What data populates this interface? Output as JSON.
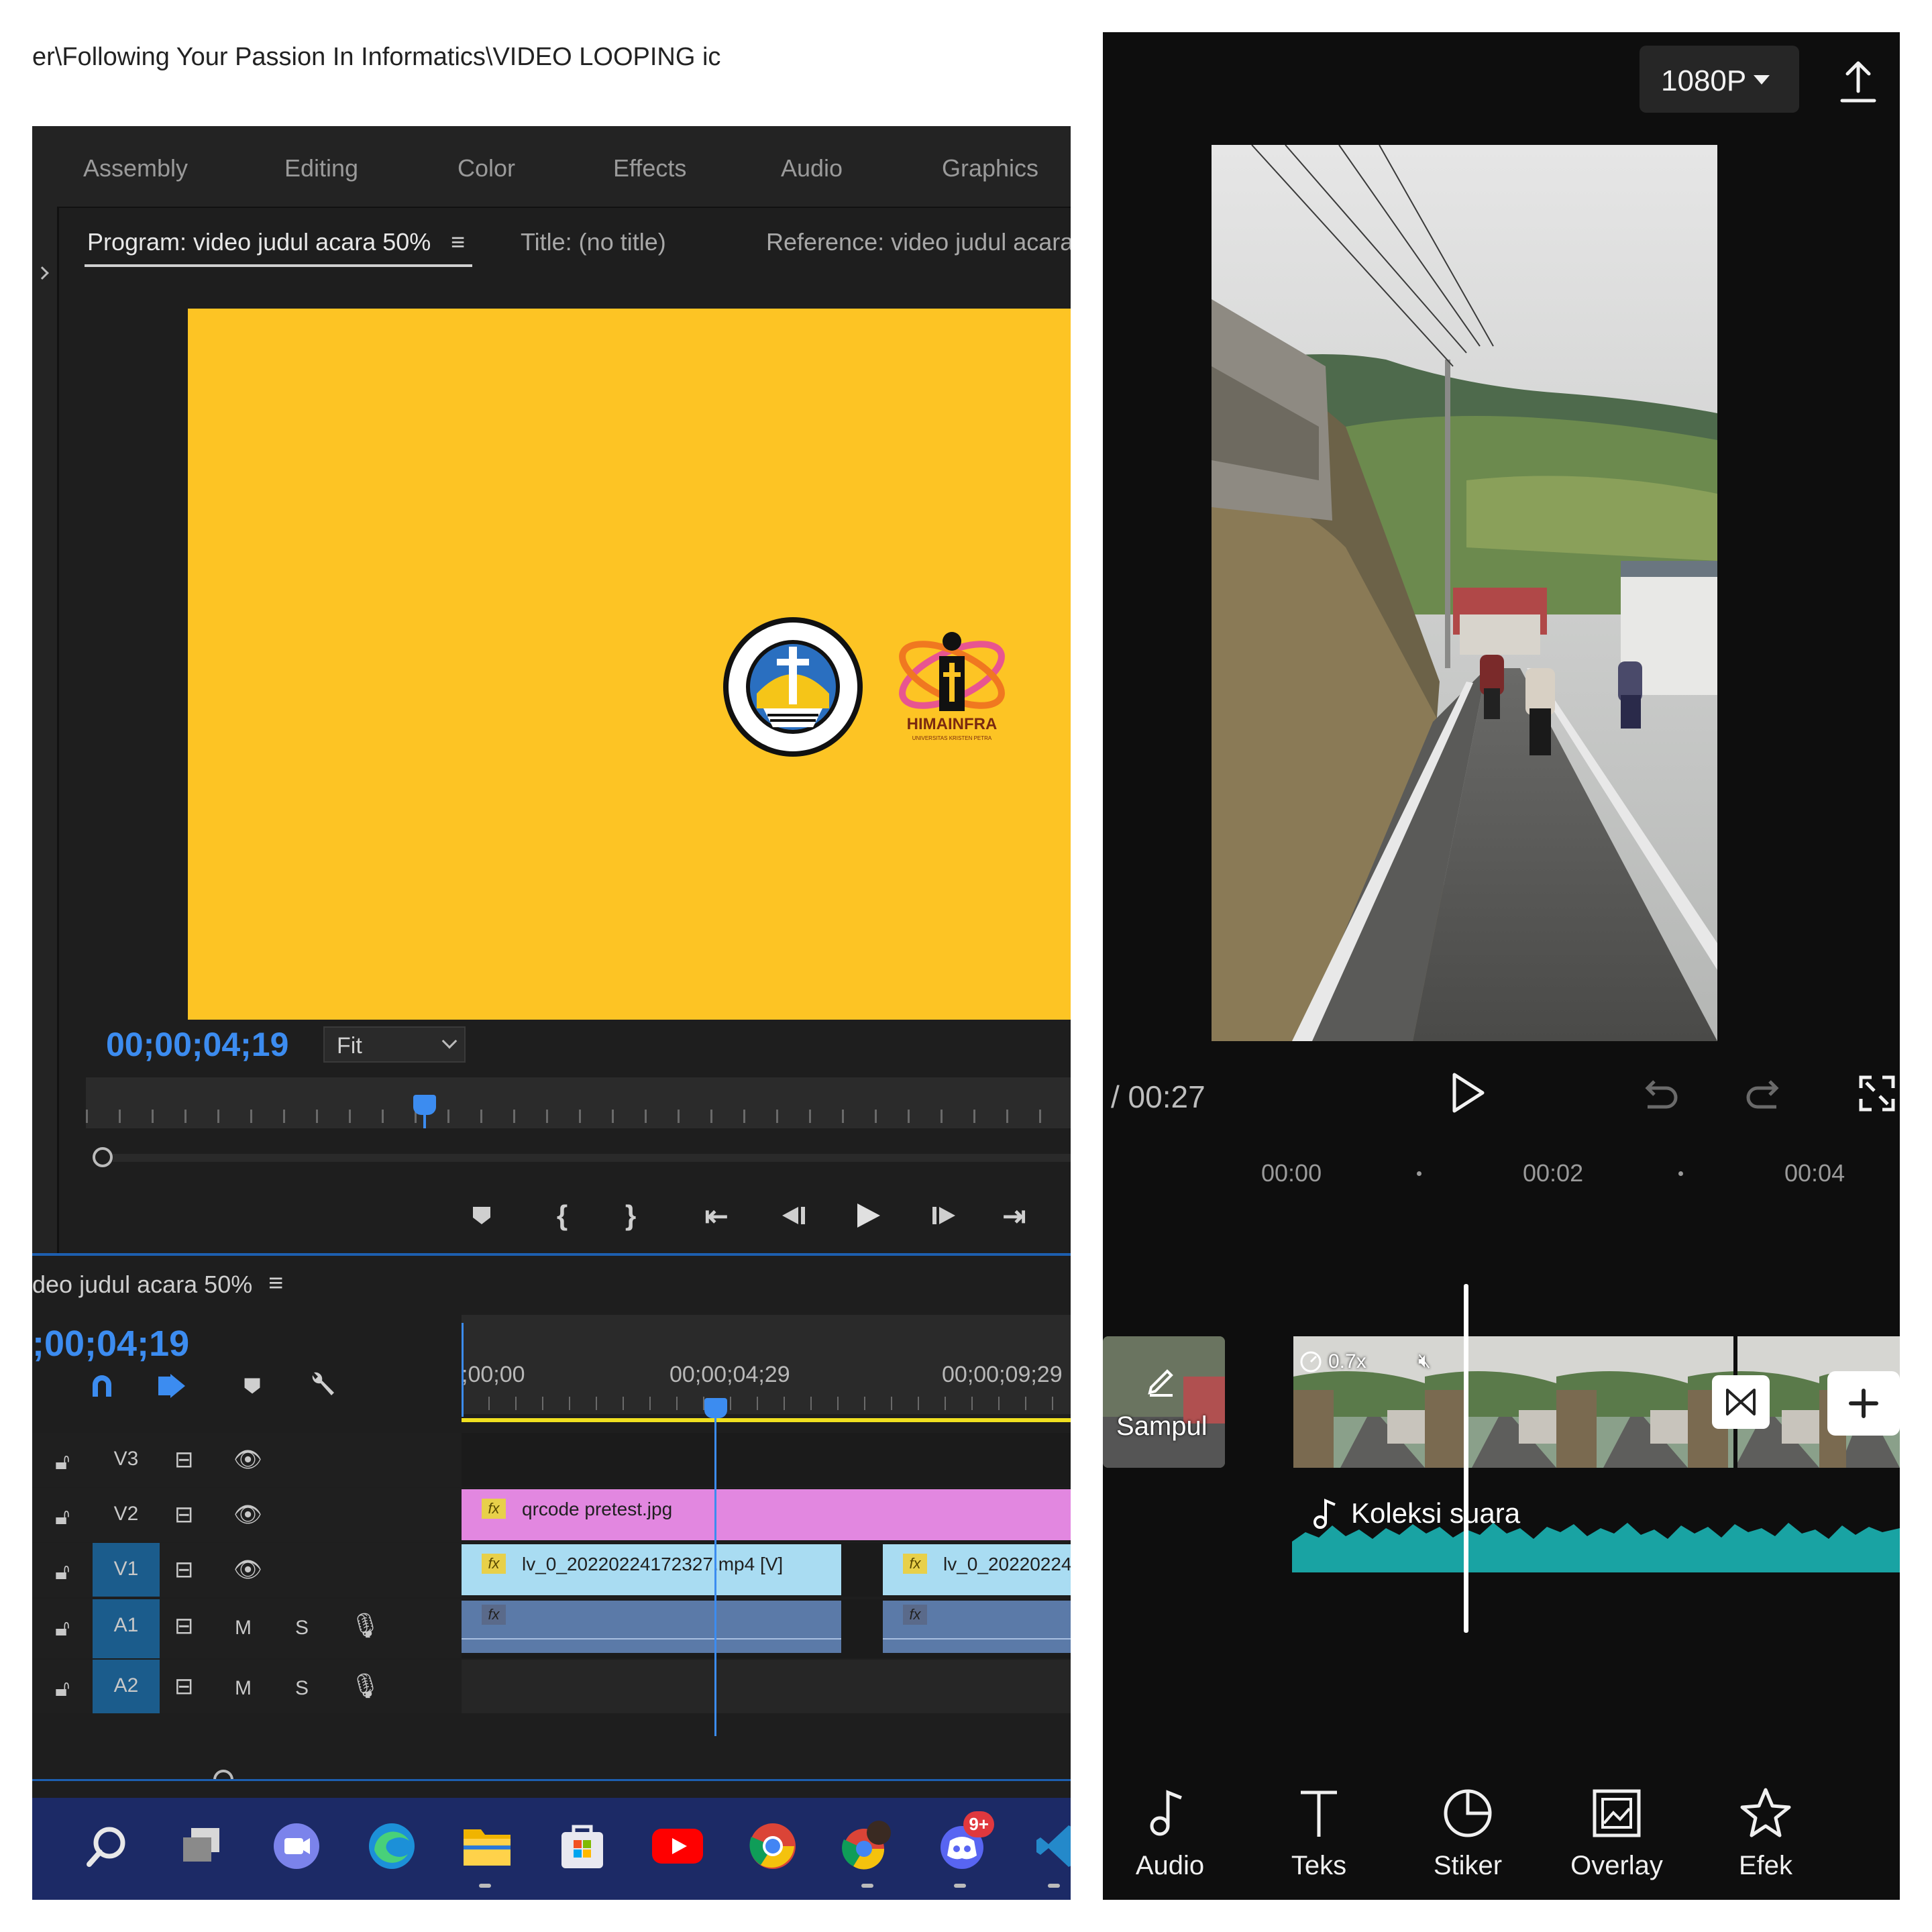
{
  "premiere": {
    "path_text": "er\\Following Your Passion In Informatics\\VIDEO LOOPING ic",
    "workspace_tabs": [
      "Assembly",
      "Editing",
      "Color",
      "Effects",
      "Audio",
      "Graphics"
    ],
    "program_tab": "Program: video judul acara 50%",
    "title_tab": "Title: (no title)",
    "reference_tab": "Reference: video judul acara :",
    "frame_color": "#fdc424",
    "logo_text": "HIMAINFRA",
    "logo_subtext": "UNIVERSITAS KRISTEN PETRA",
    "seal_text": "UNIVERSITAS KRISTEN PETRA",
    "program_timecode": "00;00;04;19",
    "fit_label": "Fit",
    "timeline": {
      "sequence_title": "deo judul acara 50%",
      "timecode": ";00;04;19",
      "ruler_labels": [
        ";00;00",
        "00;00;04;29",
        "00;00;09;29"
      ],
      "tracks": [
        {
          "name": "V3",
          "type": "video",
          "selected": false
        },
        {
          "name": "V2",
          "type": "video",
          "selected": false
        },
        {
          "name": "V1",
          "type": "video",
          "selected": true
        },
        {
          "name": "A1",
          "type": "audio",
          "selected": true
        },
        {
          "name": "A2",
          "type": "audio",
          "selected": true
        }
      ],
      "clips": {
        "v2": "qrcode pretest.jpg",
        "v1_a": "lv_0_20220224172327.mp4 [V]",
        "v1_b": "lv_0_20220224"
      },
      "fx_label": "fx",
      "mute_label": "M",
      "solo_label": "S"
    },
    "taskbar_badge": "9+"
  },
  "capcut": {
    "resolution": "1080P",
    "total_time": "/ 00:27",
    "ruler_labels": [
      "00:00",
      "00:02",
      "00:04"
    ],
    "cover_label": "Sampul",
    "speed": "0.7x",
    "audio_label": "Koleksi suara",
    "toolbar": [
      "Audio",
      "Teks",
      "Stiker",
      "Overlay",
      "Efek"
    ],
    "accent_audio": "#19a3a3"
  }
}
